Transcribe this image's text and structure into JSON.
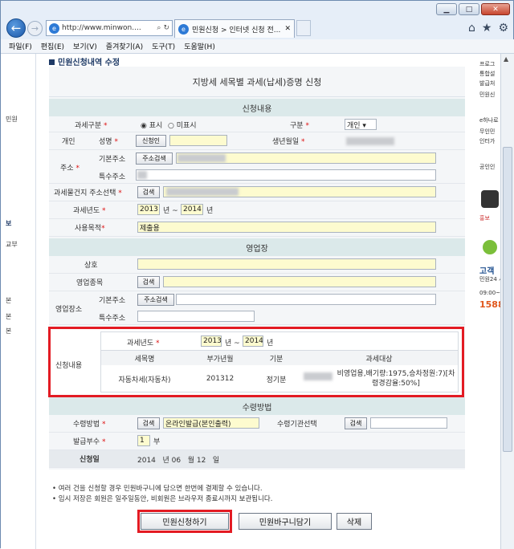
{
  "browser": {
    "address": "http://www.minwon....",
    "tab_title": "민원신청 > 인터넷 신청 전...",
    "menu": [
      "파일(F)",
      "편집(E)",
      "보기(V)",
      "즐겨찾기(A)",
      "도구(T)",
      "도움말(H)"
    ]
  },
  "left_nav": {
    "items": [
      "민원",
      "보",
      "교부",
      "본",
      "본",
      "본"
    ]
  },
  "right_panel": {
    "items": [
      "프로그",
      "통합설",
      "발급처",
      "민원신",
      "e하나로",
      "무인민",
      "인터가",
      "공인인",
      "홍보",
      "고객",
      "민원24 시",
      "09:00~1",
      "1588"
    ]
  },
  "page": {
    "section_title": "민원신청내역 수정",
    "form_title": "지방세 세목별 과세(납세)증명 신청",
    "sections": {
      "apply": "신청내용",
      "business": "영업장",
      "receive": "수령방법"
    },
    "apply": {
      "tax_type_label": "과세구분",
      "tax_type_options": [
        "표시",
        "미표시"
      ],
      "category_label": "구분",
      "category_value": "개인",
      "person_label": "개인",
      "name_label": "성명",
      "applicant_button": "신청인",
      "birth_label": "생년월일",
      "address_label": "주소",
      "basic_address_label": "기본주소",
      "address_search_button": "주소검색",
      "detail_address_label": "특수주소",
      "property_address_label": "과세물건지 주소선택",
      "search_button": "검색",
      "tax_year_label": "과세년도",
      "tax_year_from": "2013",
      "tax_year_sep": "년 ~",
      "tax_year_to": "2014",
      "tax_year_suffix": "년",
      "purpose_label": "사용목적",
      "purpose_value": "제출용"
    },
    "business": {
      "name_label": "상호",
      "type_label": "영업종목",
      "search_button": "검색",
      "location_label": "영업장소",
      "basic_address_label": "기본주소",
      "address_search_button": "주소검색",
      "detail_address_label": "특수주소"
    },
    "apply_detail": {
      "label": "신청내용",
      "tax_year_label": "과세년도",
      "tax_year_from": "2013",
      "tax_year_sep": "년 ~",
      "tax_year_to": "2014",
      "tax_year_suffix": "년",
      "columns": [
        "세목명",
        "부가년월",
        "기분",
        "과세대상"
      ],
      "row": [
        "자동차세(자동차)",
        "201312",
        "정기분",
        "비영업용,배기량:1975,승차정원:7)[차령경감율:50%]"
      ]
    },
    "receive": {
      "method_label": "수령방법",
      "search_button": "검색",
      "method_value": "온라인발급(본인출력)",
      "agency_label": "수령기관선택",
      "agency_search_button": "검색",
      "copies_label": "발급부수",
      "copies_value": "1",
      "copies_unit": "부",
      "date_label": "신청일",
      "date_year": "2014",
      "date_year_unit": "년",
      "date_month": "06",
      "date_month_unit": "월",
      "date_day": "12",
      "date_day_unit": "일"
    },
    "notes": [
      "• 여러 건을 신청할 경우 민원바구니에 담으면 한번에 결제할 수 있습니다.",
      "• 임시 저장은 회원은 일주일동안, 비회원은 브라우저 종료시까지 보관됩니다."
    ],
    "buttons": {
      "submit": "민원신청하기",
      "cart": "민원바구니담기",
      "delete": "삭제"
    }
  },
  "colors": {
    "highlight": "#e31b23",
    "section_bg": "#dbe9ea",
    "input_yellow": "#fdfbcf"
  }
}
